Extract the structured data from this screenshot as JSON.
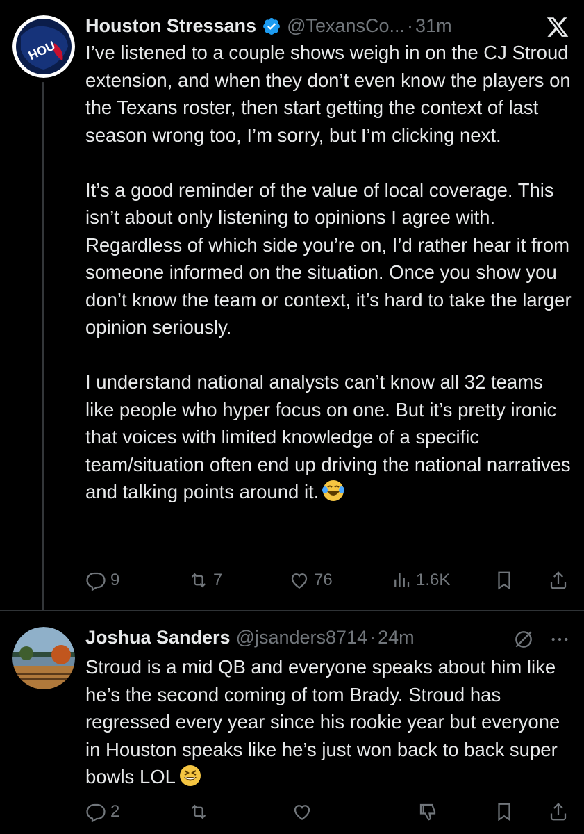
{
  "tweet1": {
    "author_name": "Houston Stressans",
    "handle": "@TexansCo...",
    "separator": "·",
    "time": "31m",
    "paragraphs": [
      "I’ve listened to a couple shows weigh in on the CJ Stroud extension, and when they don’t even know the players on the Texans roster, then start getting the context of last season wrong too, I’m sorry, but I’m clicking next.",
      "It’s a good reminder of the value of local coverage. This isn’t about only listening to opinions I agree with. Regardless of which side you’re on, I’d rather hear it from someone informed on the situation. Once you show you don’t know the team or context, it’s hard to take the larger opinion seriously.",
      "I understand national analysts can’t know all 32 teams like people who hyper focus on one. But it’s pretty ironic that voices with limited knowledge of a specific team/situation often end up driving the national narratives and talking points around it."
    ],
    "stats": {
      "replies": "9",
      "reposts": "7",
      "likes": "76",
      "views": "1.6K"
    }
  },
  "tweet2": {
    "author_name": "Joshua Sanders",
    "handle": "@jsanders8714",
    "separator": "·",
    "time": "24m",
    "text": "Stroud is a mid QB and everyone speaks about him like he’s the second coming of tom Brady. Stroud has regressed every year since his rookie year but everyone in Houston speaks like he’s just won back to back super bowls LOL",
    "stats": {
      "replies": "2"
    }
  },
  "colors": {
    "background": "#000000",
    "text_primary": "#e7e9ea",
    "text_secondary": "#71767b",
    "verified_blue": "#1d9bf0",
    "divider": "#2f3336"
  },
  "icons": [
    "x-logo-icon",
    "verified-badge-icon",
    "reply-icon",
    "repost-icon",
    "like-icon",
    "views-icon",
    "bookmark-icon",
    "share-icon",
    "grok-icon",
    "more-icon",
    "downvote-icon",
    "laughing-tears-emoji",
    "grinning-squint-emoji"
  ]
}
